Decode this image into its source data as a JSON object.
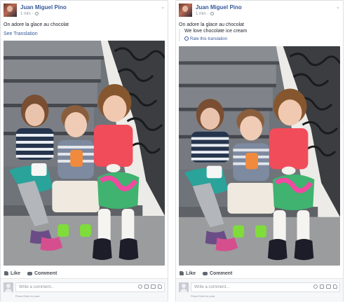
{
  "posts": [
    {
      "author": "Juan Miguel Pino",
      "time": "1 min",
      "text": "On adore la glace au chocolat",
      "see_translation": "See Translation",
      "like_label": "Like",
      "comment_label": "Comment",
      "comment_placeholder": "Write a comment...",
      "comment_hint": "Press Enter to post."
    },
    {
      "author": "Juan Miguel Pino",
      "time": "1 min",
      "text": "On adore la glace au chocolat",
      "translation": "We love chocolate ice cream",
      "rate_translation": "Rate this translation",
      "like_label": "Like",
      "comment_label": "Comment",
      "comment_placeholder": "Write a comment...",
      "comment_hint": "Press Enter to post."
    }
  ],
  "icons": {
    "author_avatar": "avatar",
    "audience": "globe-icon",
    "options": "chevron-down-icon",
    "like": "thumbs-up-icon",
    "comment": "speech-bubble-icon",
    "composer": [
      "emoji-icon",
      "camera-icon",
      "gif-icon",
      "sticker-icon"
    ]
  },
  "colors": {
    "link": "#365899",
    "meta": "#90949c",
    "text": "#1d2129",
    "border": "#dddfe2"
  }
}
